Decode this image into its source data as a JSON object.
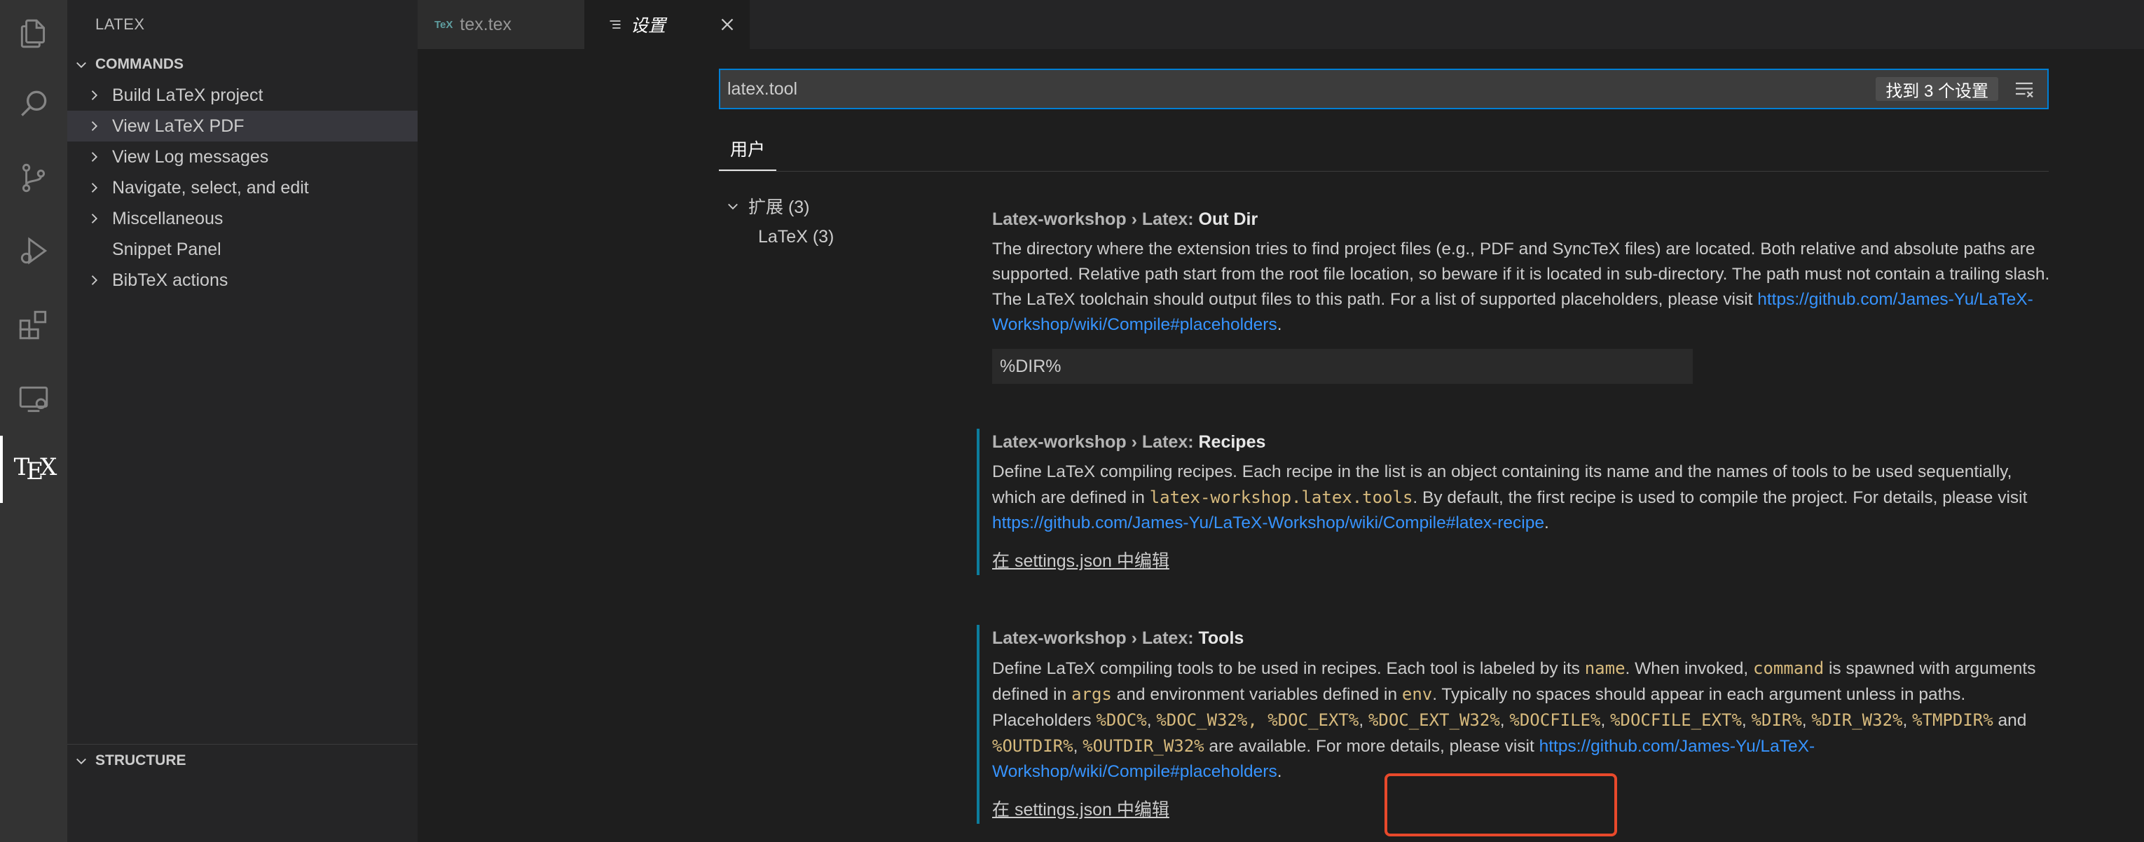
{
  "activity_bar": {
    "items": [
      {
        "name": "explorer-icon"
      },
      {
        "name": "search-icon"
      },
      {
        "name": "source-control-icon"
      },
      {
        "name": "run-debug-icon"
      },
      {
        "name": "extensions-icon"
      },
      {
        "name": "remote-explorer-icon"
      },
      {
        "name": "tex-icon",
        "label": "TEX",
        "active": true
      }
    ]
  },
  "sidebar": {
    "title": "LATEX",
    "commands_header": "COMMANDS",
    "commands": [
      {
        "label": "Build LaTeX project",
        "expandable": true
      },
      {
        "label": "View LaTeX PDF",
        "expandable": true,
        "selected": true
      },
      {
        "label": "View Log messages",
        "expandable": true
      },
      {
        "label": "Navigate, select, and edit",
        "expandable": true
      },
      {
        "label": "Miscellaneous",
        "expandable": true
      },
      {
        "label": "Snippet Panel",
        "expandable": false
      },
      {
        "label": "BibTeX actions",
        "expandable": true
      }
    ],
    "structure_header": "STRUCTURE"
  },
  "tabs": [
    {
      "label": "tex.tex",
      "icon": "TeX",
      "active": false
    },
    {
      "label": "设置",
      "active": true
    }
  ],
  "settings": {
    "search_value": "latex.tool",
    "found_label": "找到 3 个设置",
    "scope_tab": "用户",
    "toc": {
      "group_label": "扩展 (3)",
      "child_label": "LaTeX (3)"
    },
    "items": [
      {
        "category": "Latex-workshop › Latex: ",
        "name": "Out Dir",
        "desc_1": "The directory where the extension tries to find project files (e.g., PDF and SyncTeX files) are located. Both relative and absolute paths are supported. Relative path start from the root file location, so beware if it is located in sub-directory. The path must not contain a trailing slash. The LaTeX toolchain should output files to this path. For a list of supported placeholders, please visit ",
        "link": "https://github.com/James-Yu/LaTeX-Workshop/wiki/Compile#placeholders",
        "desc_end": ".",
        "value": "%DIR%"
      },
      {
        "category": "Latex-workshop › Latex: ",
        "name": "Recipes",
        "desc_1": "Define LaTeX compiling recipes. Each recipe in the list is an object containing its name and the names of tools to be used sequentially, which are defined in ",
        "code_1": "latex-workshop.latex.tools",
        "desc_2": ". By default, the first recipe is used to compile the project. For details, please visit ",
        "link": "https://github.com/James-Yu/LaTeX-Workshop/wiki/Compile#latex-recipe",
        "desc_end": ".",
        "edit_label": "在 settings.json 中编辑"
      },
      {
        "category": "Latex-workshop › Latex: ",
        "name": "Tools",
        "desc_1": "Define LaTeX compiling tools to be used in recipes. Each tool is labeled by its ",
        "code_name": "name",
        "desc_2": ". When invoked, ",
        "code_command": "command",
        "desc_3": " is spawned with arguments defined in ",
        "code_args": "args",
        "desc_4": " and environment variables defined in ",
        "code_env": "env",
        "desc_5": ". Typically no spaces should appear in each argument unless in paths. Placeholders ",
        "placeholders_1": "%DOC%",
        "sep_1": ", ",
        "placeholders_2": "%DOC_W32%, %DOC_EXT%",
        "sep_2": ", ",
        "placeholders_3": "%DOC_EXT_W32%",
        "sep_3": ", ",
        "placeholders_4": "%DOCFILE%",
        "sep_4": ", ",
        "placeholders_5": "%DOCFILE_EXT%",
        "sep_5": ", ",
        "placeholders_6": "%DIR%",
        "sep_6": ", ",
        "placeholders_7": "%DIR_W32%",
        "sep_7": ", ",
        "placeholders_8": "%TMPDIR%",
        "and": " and ",
        "placeholders_9": "%OUTDIR%",
        "sep_9": ", ",
        "placeholders_10": "%OUTDIR_W32%",
        "desc_6": " are available. For more details, please visit ",
        "link": "https://github.com/James-Yu/LaTeX-Workshop/wiki/Compile#placeholders",
        "desc_end": ".",
        "edit_label": "在 settings.json 中编辑"
      }
    ]
  },
  "colors": {
    "accent": "#007fd4",
    "link": "#3794ff",
    "code": "#d7ba7d",
    "modified_bar": "#0c7d9d",
    "highlight_box": "#e8492b"
  }
}
